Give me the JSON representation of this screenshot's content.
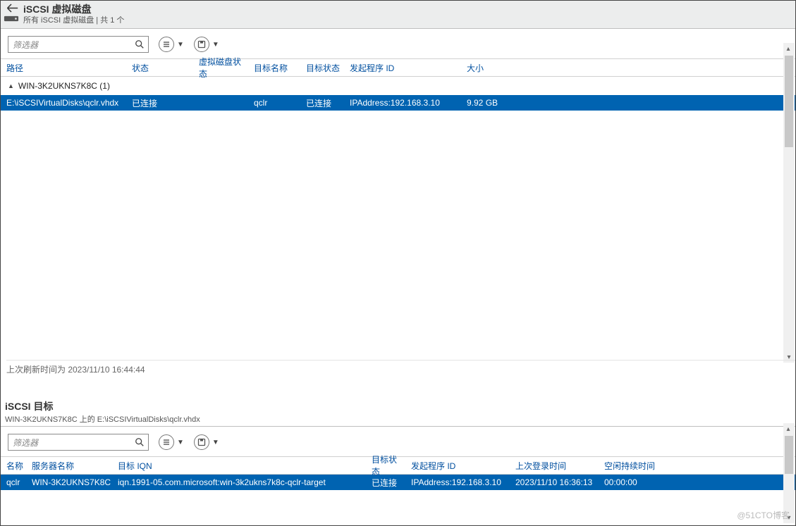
{
  "pane1": {
    "title": "iSCSI 虚拟磁盘",
    "subtitle": "所有 iSCSI 虚拟磁盘 | 共 1 个",
    "filter_placeholder": "筛选器",
    "columns": {
      "path": "路径",
      "status": "状态",
      "vdstatus": "虚拟磁盘状态",
      "target_name": "目标名称",
      "target_status": "目标状态",
      "initiator": "发起程序 ID",
      "size": "大小"
    },
    "group": "WIN-3K2UKNS7K8C (1)",
    "row": {
      "path": "E:\\iSCSIVirtualDisks\\qclr.vhdx",
      "status": "已连接",
      "vdstatus": "",
      "target_name": "qclr",
      "target_status": "已连接",
      "initiator": "IPAddress:192.168.3.10",
      "size": "9.92 GB"
    },
    "status_line": "上次刷新时间为 2023/11/10 16:44:44"
  },
  "pane2": {
    "title": "iSCSI 目标",
    "subtitle": "WIN-3K2UKNS7K8C 上的 E:\\iSCSIVirtualDisks\\qclr.vhdx",
    "filter_placeholder": "筛选器",
    "columns": {
      "name": "名称",
      "server": "服务器名称",
      "iqn": "目标 IQN",
      "target_status": "目标状态",
      "initiator": "发起程序 ID",
      "last_login": "上次登录时间",
      "idle": "空闲持续时间"
    },
    "row": {
      "name": "qclr",
      "server": "WIN-3K2UKNS7K8C",
      "iqn": "iqn.1991-05.com.microsoft:win-3k2ukns7k8c-qclr-target",
      "target_status": "已连接",
      "initiator": "IPAddress:192.168.3.10",
      "last_login": "2023/11/10 16:36:13",
      "idle": "00:00:00"
    }
  },
  "watermark": "@51CTO博客"
}
